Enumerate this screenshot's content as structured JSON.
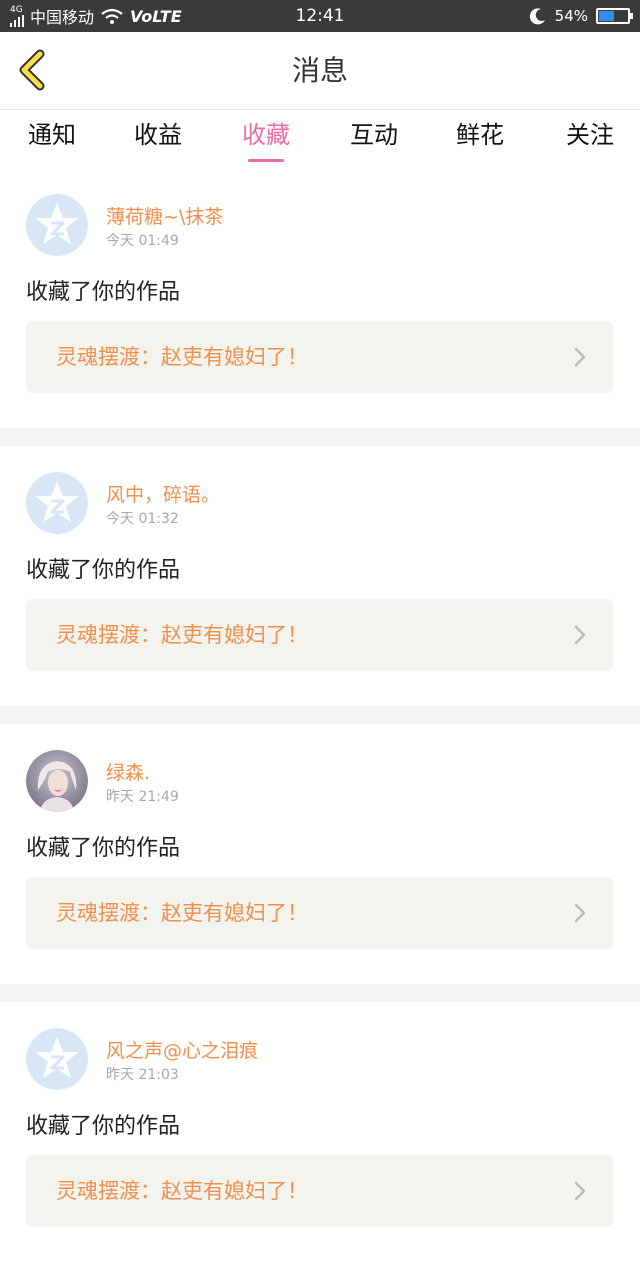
{
  "status_bar": {
    "network_type": "4G",
    "carrier": "中国移动",
    "volte": "VoLTE",
    "time": "12:41",
    "battery": "54%",
    "battery_level": 0.54,
    "battery_color": "#2f8ff0"
  },
  "header": {
    "title": "消息",
    "back_icon": "chevron-left-icon"
  },
  "tabs": [
    {
      "label": "通知",
      "active": false
    },
    {
      "label": "收益",
      "active": false
    },
    {
      "label": "收藏",
      "active": true
    },
    {
      "label": "互动",
      "active": false
    },
    {
      "label": "鲜花",
      "active": false
    },
    {
      "label": "关注",
      "active": false
    }
  ],
  "colors": {
    "accent": "#ec6da1",
    "username": "#f0904e",
    "card_bg": "#f4f4ee"
  },
  "items": [
    {
      "username": "薄荷糖~\\抹茶",
      "time": "今天 01:49",
      "action": "收藏了你的作品",
      "work_title": "灵魂摆渡：赵吏有媳妇了！",
      "avatar": "default-avatar"
    },
    {
      "username": "风中，碎语。",
      "time": "今天 01:32",
      "action": "收藏了你的作品",
      "work_title": "灵魂摆渡：赵吏有媳妇了！",
      "avatar": "default-avatar"
    },
    {
      "username": "绿森.",
      "time": "昨天 21:49",
      "action": "收藏了你的作品",
      "work_title": "灵魂摆渡：赵吏有媳妇了！",
      "avatar": "photo-avatar"
    },
    {
      "username": "风之声@心之泪痕",
      "time": "昨天 21:03",
      "action": "收藏了你的作品",
      "work_title": "灵魂摆渡：赵吏有媳妇了！",
      "avatar": "default-avatar"
    }
  ]
}
